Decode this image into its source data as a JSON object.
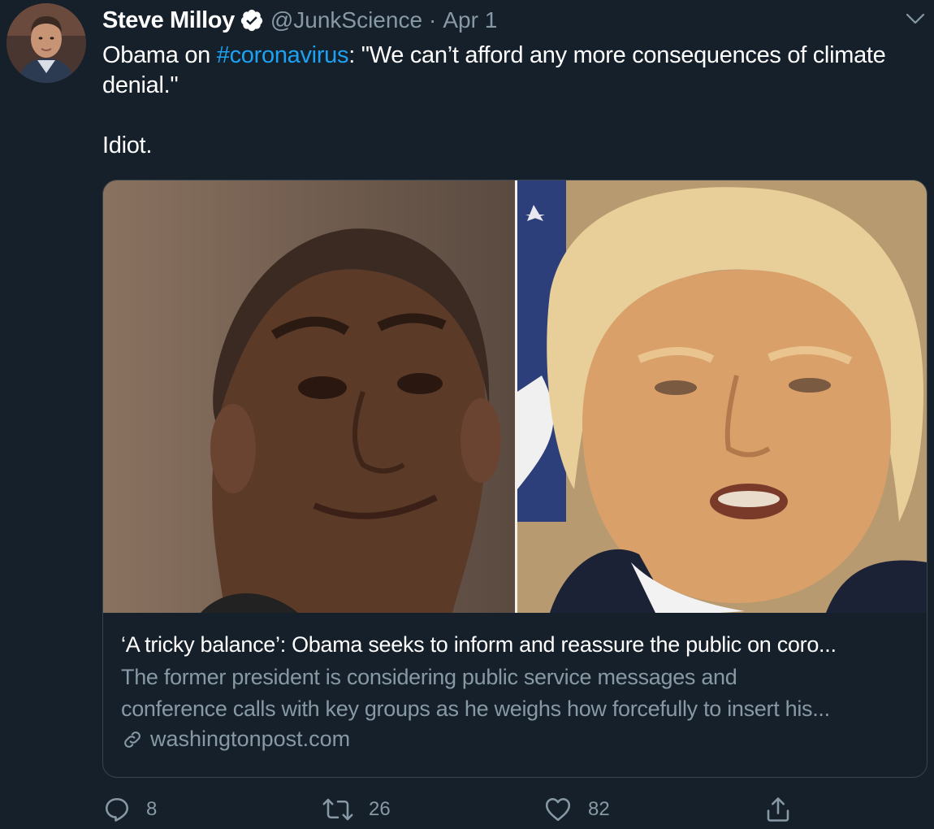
{
  "author": {
    "display_name": "Steve Milloy",
    "handle": "@JunkScience",
    "separator": "·",
    "date": "Apr 1"
  },
  "tweet": {
    "line1_prefix": "Obama on ",
    "hashtag": "#coronavirus",
    "line1_suffix": ": \"We can’t afford any more consequences of climate",
    "line2": "denial.\"",
    "line4": "Idiot."
  },
  "card": {
    "title": "‘A tricky balance’: Obama seeks to inform and reassure the public on coro...",
    "description_line1": "The former president is considering public service messages and",
    "description_line2": "conference calls with key groups as he weighs how forcefully to insert his...",
    "domain": "washingtonpost.com"
  },
  "actions": {
    "reply_count": "8",
    "retweet_count": "26",
    "like_count": "82"
  },
  "icons": {
    "verified": "verified-badge-icon",
    "caret": "chevron-down-icon",
    "link": "link-icon",
    "reply": "reply-icon",
    "retweet": "retweet-icon",
    "like": "heart-icon",
    "share": "share-icon"
  },
  "colors": {
    "background": "#15202b",
    "accent": "#1da1f2",
    "secondary_text": "#8899a6",
    "border": "#38444d"
  }
}
